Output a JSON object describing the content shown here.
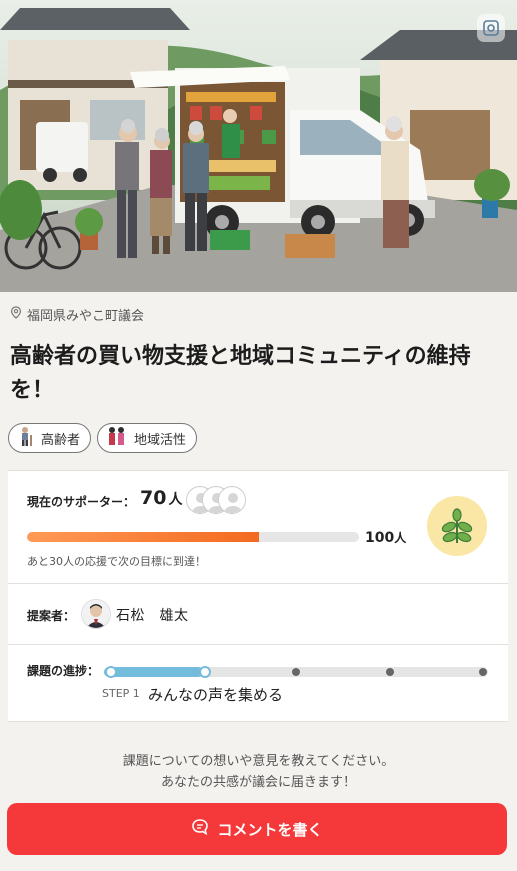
{
  "location": {
    "icon": "pin-icon",
    "text": "福岡県みやこ町議会"
  },
  "title": "高齢者の買い物支援と地域コミュニティの維持を！",
  "tags": [
    {
      "icon": "elderly-person-icon",
      "label": "高齢者"
    },
    {
      "icon": "people-icon",
      "label": "地域活性"
    }
  ],
  "supporters": {
    "label": "現在のサポーター：",
    "count": "70",
    "unit": "人",
    "goal": "100",
    "goal_unit": "人",
    "progress_percent": 70,
    "note": "あと30人の応援で次の目標に到達！"
  },
  "proposer": {
    "label": "提案者：",
    "name": "石松　雄太"
  },
  "progress": {
    "label": "課題の進捗：",
    "current_step": 1,
    "total_steps": 5,
    "step_label": "STEP 1",
    "step_name": "みんなの声を集める"
  },
  "prompt": {
    "line1": "課題についての想いや意見を教えてください。",
    "line2": "あなたの共感が議会に届きます！"
  },
  "cta": {
    "icon": "chat-bubble-icon",
    "label": "コメントを書く"
  },
  "colors": {
    "accent": "#f5383a",
    "progress_bar": "#f36a1f",
    "step_track": "#74bcdc",
    "plant_bg": "#fbe7a5"
  }
}
